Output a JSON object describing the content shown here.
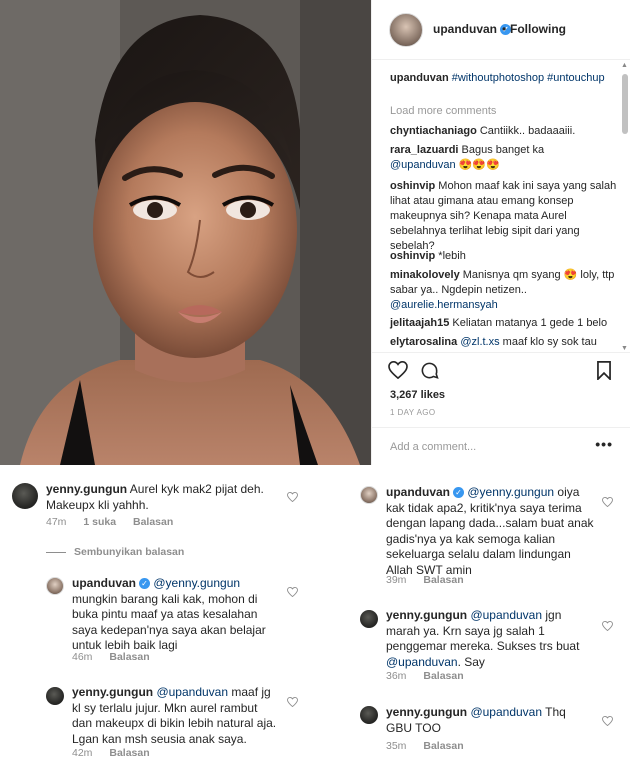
{
  "post": {
    "username": "upanduvan",
    "follow_status": "Following",
    "caption_hashtags": "#withoutphotoshop #untouchup",
    "load_more": "Load more comments",
    "comments": [
      {
        "user": "chyntiachaniago",
        "text": "Cantiikk.. badaaaiii."
      },
      {
        "user": "rara_lazuardi",
        "text": "Bagus banget ka",
        "mention": "@upanduvan",
        "emoji": "😍😍😍"
      },
      {
        "user": "oshinvip",
        "text": "Mohon maaf kak ini saya yang salah lihat atau gimana atau emang konsep makeupnya sih? Kenapa mata Aurel sebelahnya terlihat lebig sipit dari yang sebelah?"
      },
      {
        "user": "oshinvip",
        "text": "*lebih"
      },
      {
        "user": "minakolovely",
        "text": "Manisnya qm syang 😍 loly, ttp sabar ya.. Ngdepin netizen..",
        "mention": "@aurelie.hermansyah"
      },
      {
        "user": "jelitaajah15",
        "text": "Keliatan matanya 1 gede 1 belo"
      },
      {
        "user": "elytarosalina",
        "text": "maaf klo sy sok tau",
        "mention": "@zl.t.xs"
      }
    ],
    "likes": "3,267 likes",
    "time_ago": "1 DAY AGO",
    "add_comment_placeholder": "Add a comment...",
    "more": "•••"
  },
  "left_column": {
    "thread1": {
      "user": "yenny.gungun",
      "text": "Aurel kyk mak2 pijat deh. Makeupx kli yahhh.",
      "time": "47m",
      "likes": "1 suka",
      "reply": "Balasan"
    },
    "hide_replies": "Sembunyikan balasan",
    "reply1": {
      "user": "upanduvan",
      "mention": "@yenny.gungun",
      "text": "mungkin barang kali kak, mohon di buka pintu maaf ya atas kesalahan saya kedepan'nya saya akan belajar untuk lebih baik lagi",
      "time": "46m",
      "reply": "Balasan"
    },
    "reply2": {
      "user": "yenny.gungun",
      "mention": "@upanduvan",
      "text": "maaf jg kl sy terlalu jujur. Mkn aurel rambut dan makeupx di bikin lebih natural aja. Lgan kan msh seusia anak saya.",
      "time": "42m",
      "reply": "Balasan"
    }
  },
  "right_column": {
    "reply3": {
      "user": "upanduvan",
      "mention": "@yenny.gungun",
      "text": "oiya kak tidak apa2, kritik'nya saya terima dengan lapang dada...salam buat anak gadis'nya ya kak semoga kalian sekeluarga selalu dalam lindungan Allah SWT amin",
      "time": "39m",
      "reply": "Balasan"
    },
    "reply4": {
      "user": "yenny.gungun",
      "mention": "@upanduvan",
      "text": "jgn marah ya. Krn saya jg salah 1 penggemar mereka. Sukses trs buat",
      "mention2": "@upanduvan",
      "text2": ". Say",
      "time": "36m",
      "reply": "Balasan"
    },
    "reply5": {
      "user": "yenny.gungun",
      "mention": "@upanduvan",
      "text": "Thq GBU TOO",
      "time": "35m",
      "reply": "Balasan"
    }
  },
  "colors": {
    "verified": "#3897f0",
    "text": "#262626",
    "muted": "#8e8e8e",
    "mention": "#003569"
  },
  "icons": [
    "heart-icon",
    "comment-icon",
    "bookmark-icon",
    "verified-badge-icon",
    "more-options-icon"
  ]
}
